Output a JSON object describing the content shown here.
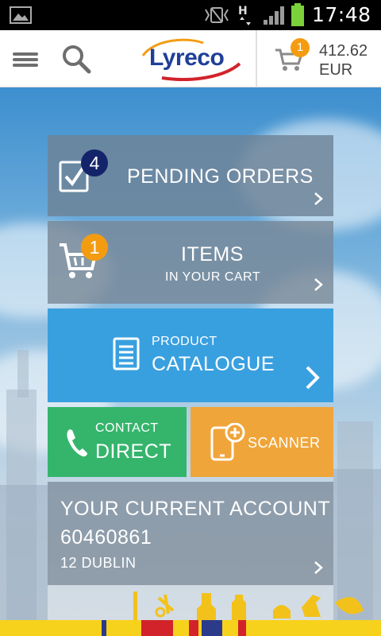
{
  "status_bar": {
    "time": "17:48",
    "icons": [
      "gallery-icon",
      "vibrate-icon",
      "h-network-icon",
      "signal-icon",
      "battery-icon"
    ]
  },
  "header": {
    "logo_text": "Lyreco",
    "cart_count": "1",
    "cart_total": "412.62",
    "currency": "EUR"
  },
  "tiles": {
    "pending_orders": {
      "badge": "4",
      "label": "PENDING ORDERS"
    },
    "cart": {
      "badge": "1",
      "title": "ITEMS",
      "subtitle": "IN YOUR CART"
    },
    "catalogue": {
      "small": "PRODUCT",
      "big": "CATALOGUE"
    },
    "contact": {
      "small": "CONTACT",
      "big": "DIRECT"
    },
    "scanner": {
      "label": "SCANNER"
    },
    "account": {
      "title": "YOUR CURRENT ACCOUNT",
      "number": "60460861",
      "location": "12 DUBLIN"
    }
  },
  "colors": {
    "brand_blue": "#1f3f98",
    "brand_red": "#d2232a",
    "accent_orange": "#f39c12",
    "catalogue_blue": "#39a0e0",
    "contact_green": "#35b56c",
    "scanner_orange": "#f0a53a",
    "badge_navy": "#14246a",
    "stripe_yellow": "#f7d21c"
  }
}
